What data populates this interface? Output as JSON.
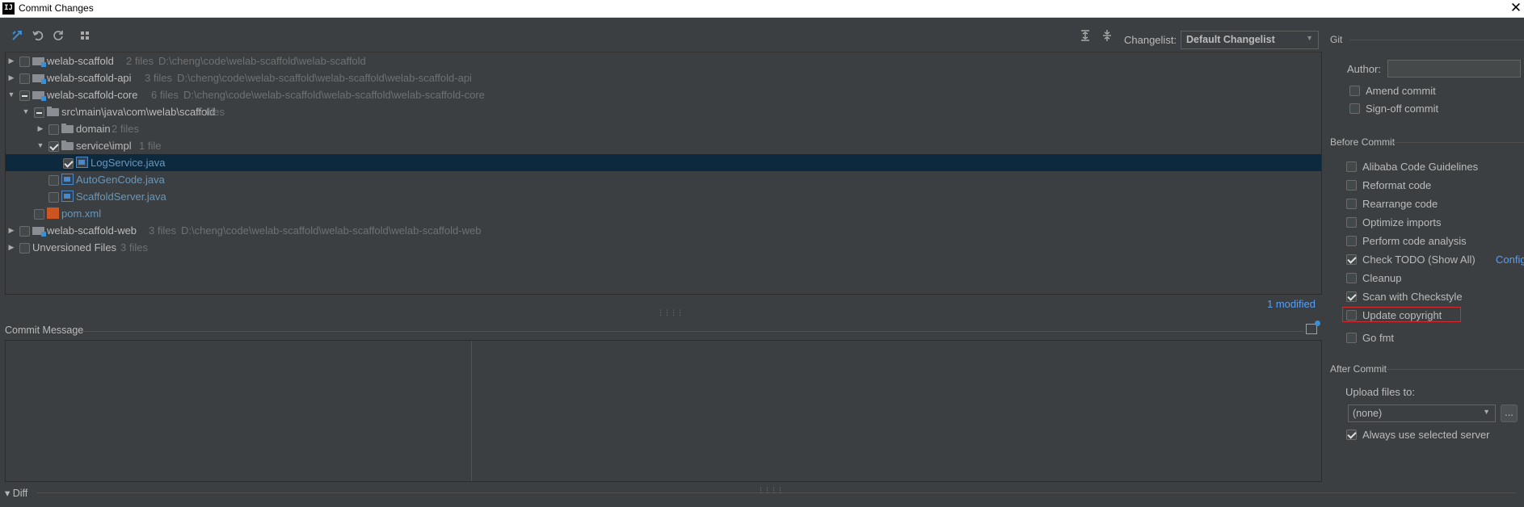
{
  "window": {
    "title": "Commit Changes",
    "app_icon": "IJ",
    "close": "✕"
  },
  "toolbar": {
    "changelist_label": "Changelist:",
    "changelist_value": "Default Changelist"
  },
  "tree": {
    "rows": [
      {
        "name": "welab-scaffold",
        "count": "2 files",
        "path": "D:\\cheng\\code\\welab-scaffold\\welab-scaffold"
      },
      {
        "name": "welab-scaffold-api",
        "count": "3 files",
        "path": "D:\\cheng\\code\\welab-scaffold\\welab-scaffold\\welab-scaffold-api"
      },
      {
        "name": "welab-scaffold-core",
        "count": "6 files",
        "path": "D:\\cheng\\code\\welab-scaffold\\welab-scaffold\\welab-scaffold-core"
      },
      {
        "name": "src\\main\\java\\com\\welab\\scaffold",
        "count": "5 files"
      },
      {
        "name": "domain",
        "count": "2 files"
      },
      {
        "name": "service\\impl",
        "count": "1 file"
      },
      {
        "name": "LogService.java"
      },
      {
        "name": "AutoGenCode.java"
      },
      {
        "name": "ScaffoldServer.java"
      },
      {
        "name": "pom.xml"
      },
      {
        "name": "welab-scaffold-web",
        "count": "3 files",
        "path": "D:\\cheng\\code\\welab-scaffold\\welab-scaffold\\welab-scaffold-web"
      },
      {
        "name": "Unversioned Files",
        "count": "3 files"
      }
    ],
    "modified_link": "1 modified"
  },
  "commit_message": {
    "label": "Commit Message",
    "value": ""
  },
  "diff": {
    "label": "Diff"
  },
  "right_panel": {
    "git_section": "Git",
    "author_label": "Author:",
    "author_value": "",
    "amend_commit": "Amend commit",
    "signoff_commit": "Sign-off commit",
    "before_commit_section": "Before Commit",
    "before_commit_options": [
      {
        "label": "Alibaba Code Guidelines",
        "checked": false
      },
      {
        "label": "Reformat code",
        "checked": false
      },
      {
        "label": "Rearrange code",
        "checked": false
      },
      {
        "label": "Optimize imports",
        "checked": false
      },
      {
        "label": "Perform code analysis",
        "checked": false
      },
      {
        "label": "Check TODO (Show All)",
        "checked": true
      },
      {
        "label": "Cleanup",
        "checked": false
      },
      {
        "label": "Scan with Checkstyle",
        "checked": true
      },
      {
        "label": "Update copyright",
        "checked": false
      },
      {
        "label": "Go fmt",
        "checked": false
      }
    ],
    "configure_link": "Configure",
    "after_commit_section": "After Commit",
    "upload_label": "Upload files to:",
    "upload_value": "(none)",
    "more_button": "...",
    "always_use_server": "Always use selected server"
  },
  "colors": {
    "background": "#3c3f41",
    "selection": "#0d293e",
    "link": "#589df6",
    "java_file": "#6897bb",
    "highlight_border": "#d9282c"
  }
}
